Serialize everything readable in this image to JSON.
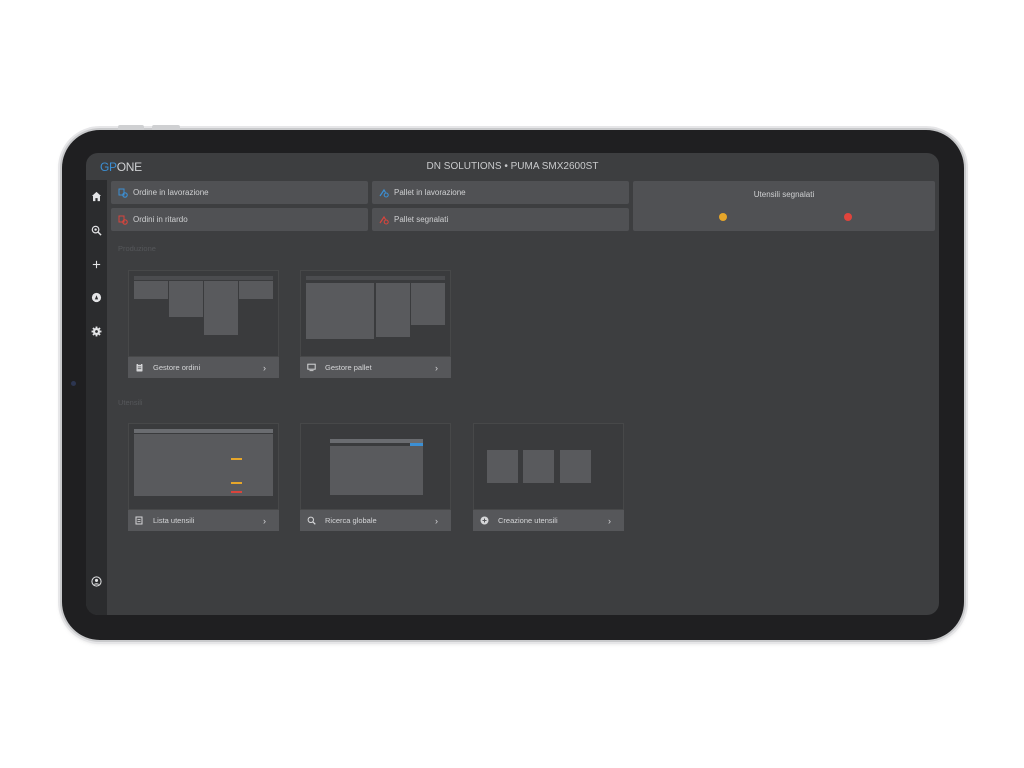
{
  "header": {
    "logo_gp": "GP",
    "logo_one": "ONE",
    "title": "DN SOLUTIONS • PUMA SMX2600ST"
  },
  "sidebar": {
    "items": [
      {
        "name": "home",
        "icon": "home-icon"
      },
      {
        "name": "global-search",
        "icon": "search-gear-icon"
      },
      {
        "name": "add",
        "icon": "plus-icon"
      },
      {
        "name": "tool",
        "icon": "circle-tool-icon"
      },
      {
        "name": "settings",
        "icon": "gear-icon"
      }
    ],
    "bottom_item": {
      "name": "account",
      "icon": "user-icon"
    }
  },
  "status_cards": [
    {
      "label": "Ordine in lavorazione",
      "icon": "order-gear-icon",
      "color": "#3b8fd4"
    },
    {
      "label": "Pallet in lavorazione",
      "icon": "pallet-gear-icon",
      "color": "#3b8fd4"
    },
    {
      "label": "Ordini in ritardo",
      "icon": "order-alert-icon",
      "color": "#d9443c"
    },
    {
      "label": "Pallet segnalati",
      "icon": "pallet-alert-icon",
      "color": "#d9443c"
    }
  ],
  "flagged_tools": {
    "title": "Utensili segnalati",
    "warning_color": "#e6a62a",
    "error_color": "#e0443c"
  },
  "sections": {
    "production": {
      "label": "Produzione",
      "tiles": [
        {
          "label": "Gestore ordini",
          "icon": "clipboard-icon"
        },
        {
          "label": "Gestore pallet",
          "icon": "monitor-icon"
        }
      ]
    },
    "tools": {
      "label": "Utensili",
      "tiles": [
        {
          "label": "Lista utensili",
          "icon": "list-tool-icon"
        },
        {
          "label": "Ricerca globale",
          "icon": "search-gear-icon"
        },
        {
          "label": "Creazione utensili",
          "icon": "plus-circle-icon"
        }
      ]
    }
  },
  "chevron": "›"
}
